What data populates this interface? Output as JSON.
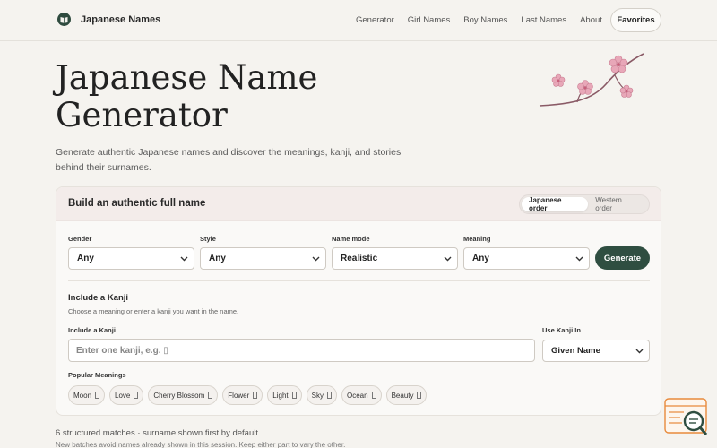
{
  "header": {
    "brand_name": "Japanese Names",
    "nav": [
      "Generator",
      "Girl Names",
      "Boy Names",
      "Last Names",
      "About"
    ],
    "favorites_label": "Favorites"
  },
  "hero": {
    "title": "Japanese Name Generator",
    "subtitle": "Generate authentic Japanese names and discover the meanings, kanji, and stories behind their surnames."
  },
  "builder": {
    "title": "Build an authentic full name",
    "order_options": [
      "Japanese order",
      "Western order"
    ],
    "order_selected": "Japanese order",
    "fields": [
      {
        "label": "Gender",
        "value": "Any"
      },
      {
        "label": "Style",
        "value": "Any"
      },
      {
        "label": "Name mode",
        "value": "Realistic"
      },
      {
        "label": "Meaning",
        "value": "Any"
      }
    ],
    "generate_label": "Generate",
    "kanji_section_title": "Include a Kanji",
    "kanji_section_hint": "Choose a meaning or enter a kanji you want in the name.",
    "kanji_input_label": "Include a Kanji",
    "kanji_input_placeholder": "Enter one kanji, e.g. ▯",
    "use_kanji_label": "Use Kanji In",
    "use_kanji_value": "Given Name",
    "popular_label": "Popular Meanings",
    "popular_meanings": [
      "Moon",
      "Love",
      "Cherry Blossom",
      "Flower",
      "Light",
      "Sky",
      "Ocean",
      "Beauty"
    ]
  },
  "footer": {
    "matches": "6 structured matches · surname shown first by default",
    "note": "New batches avoid names already shown in this session. Keep either part to vary the other."
  },
  "colors": {
    "accent": "#2f4e41",
    "blossom": "#e8a7b8",
    "branch": "#8a5a66",
    "background": "#f5f3ef"
  }
}
